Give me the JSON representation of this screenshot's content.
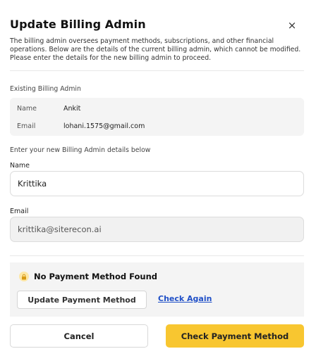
{
  "modal": {
    "title": "Update Billing Admin",
    "close_symbol": "×",
    "description": "The billing admin oversees payment methods, subscriptions, and other financial operations. Below are the details of the current billing admin, which cannot be modified. Please enter the details for the new billing admin to proceed."
  },
  "existing": {
    "section_label": "Existing Billing Admin",
    "name_key": "Name",
    "name_value": "Ankit",
    "email_key": "Email",
    "email_value": "lohani.1575@gmail.com"
  },
  "new_admin": {
    "section_label": "Enter your new Billing Admin details below",
    "name_label": "Name",
    "name_value": "Krittika",
    "email_label": "Email",
    "email_value": "krittika@siterecon.ai"
  },
  "payment": {
    "warning_title": "No Payment Method Found",
    "update_button": "Update Payment Method",
    "check_again_link": "Check Again",
    "icon": "lock-icon"
  },
  "footer": {
    "cancel_label": "Cancel",
    "check_payment_label": "Check Payment Method"
  },
  "colors": {
    "primary": "#f8c630",
    "link": "#1f4fc7",
    "panel": "#f4f4f4"
  }
}
